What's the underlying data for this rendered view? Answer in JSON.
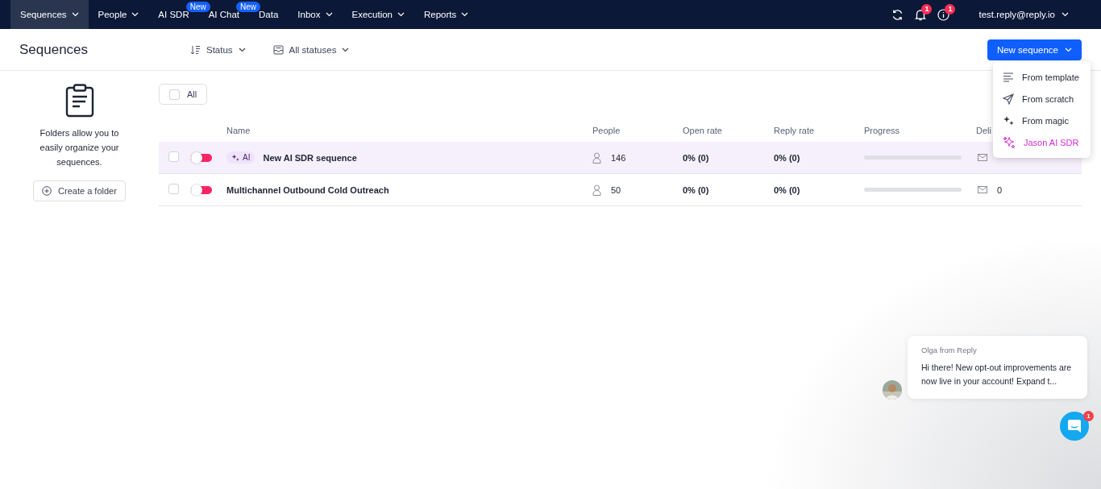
{
  "nav": {
    "items": [
      {
        "label": "Sequences",
        "selected": true,
        "dropdown": true
      },
      {
        "label": "People",
        "selected": false,
        "dropdown": true
      },
      {
        "label": "AI SDR",
        "selected": false,
        "dropdown": false,
        "badge": "New"
      },
      {
        "label": "AI Chat",
        "selected": false,
        "dropdown": false,
        "badge": "New"
      },
      {
        "label": "Data",
        "selected": false,
        "dropdown": false
      },
      {
        "label": "Inbox",
        "selected": false,
        "dropdown": true
      },
      {
        "label": "Execution",
        "selected": false,
        "dropdown": true
      },
      {
        "label": "Reports",
        "selected": false,
        "dropdown": true
      }
    ],
    "notifications_badge": "1",
    "help_badge": "1",
    "account": "test.reply@reply.io"
  },
  "header": {
    "title": "Sequences",
    "sort_label": "Status",
    "filter_label": "All statuses",
    "new_button": "New sequence"
  },
  "menu": {
    "items": [
      {
        "label": "From template",
        "kind": "template"
      },
      {
        "label": "From scratch",
        "kind": "scratch"
      },
      {
        "label": "From magic",
        "kind": "magic"
      },
      {
        "label": "Jason AI SDR",
        "kind": "ai"
      }
    ]
  },
  "folders": {
    "text": "Folders allow you to easily organize your sequences.",
    "button": "Create a folder"
  },
  "table": {
    "select_all": {
      "label": "All",
      "checked": false
    },
    "columns": [
      "Name",
      "People",
      "Open rate",
      "Reply rate",
      "Progress",
      "Deli"
    ],
    "rows": [
      {
        "checked": false,
        "on": false,
        "hovered": true,
        "tag": "AI",
        "name": "New AI SDR sequence",
        "people": "146",
        "open_rate": "0% (0)",
        "reply_rate": "0% (0)",
        "level": 0
      },
      {
        "checked": false,
        "on": false,
        "hovered": false,
        "name": "Multichannel Outbound Cold Outreach",
        "people": "50",
        "open_rate": "0% (0)",
        "reply_rate": "0% (0)",
        "level": 0,
        "delivered": "0"
      }
    ]
  },
  "chat": {
    "sender": "Olga from Reply",
    "message": "Hi there! New opt-out improvements are now live in your account! Expand t...",
    "badge": "1"
  }
}
